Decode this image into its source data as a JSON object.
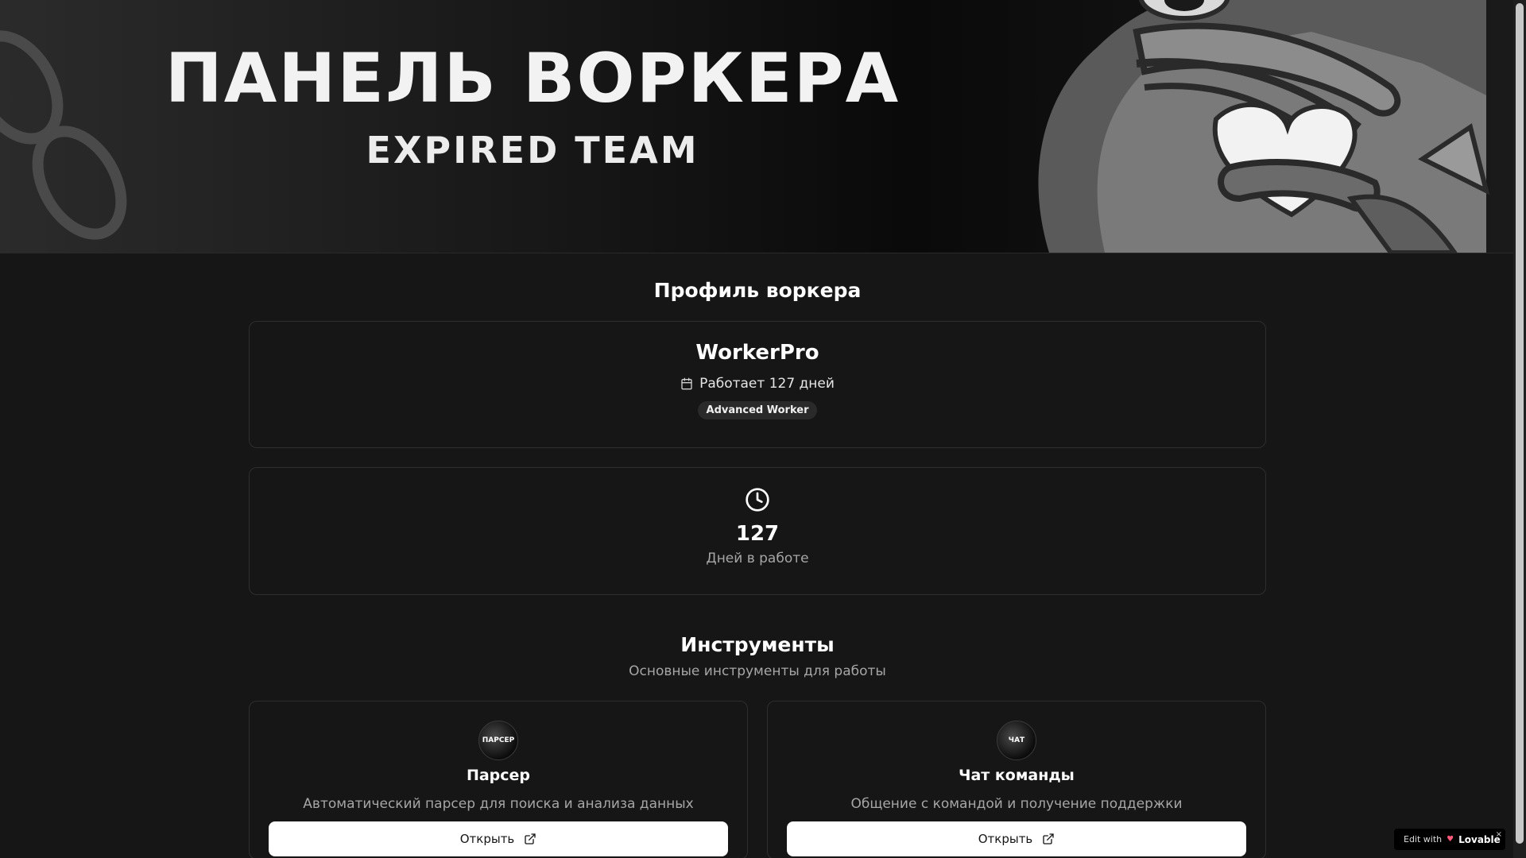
{
  "banner": {
    "title": "ПАНЕЛЬ ВОРКЕРА",
    "subtitle": "EXPIRED TEAM",
    "image_name": "mascot-frog-illustration"
  },
  "profile": {
    "section_title": "Профиль воркера",
    "username": "WorkerPro",
    "tenure_text": "Работает 127 дней",
    "badge": "Advanced Worker"
  },
  "stats": {
    "value": "127",
    "label": "Дней в работе"
  },
  "tools": {
    "section_title": "Инструменты",
    "section_subtitle": "Основные инструменты для работы",
    "items": [
      {
        "icon_text": "ПАРСЕР",
        "title": "Парсер",
        "description": "Автоматический парсер для поиска и анализа данных",
        "button": "Открыть"
      },
      {
        "icon_text": "ЧАТ",
        "title": "Чат команды",
        "description": "Общение с командой и получение поддержки",
        "button": "Открыть"
      }
    ]
  },
  "footer_badge": {
    "prefix": "Edit with",
    "brand": "Lovable",
    "close": "×"
  },
  "colors": {
    "background": "#161616",
    "card_border": "#2e2e2e",
    "button_bg": "#ffffff",
    "muted_text": "#a6a6a6"
  }
}
